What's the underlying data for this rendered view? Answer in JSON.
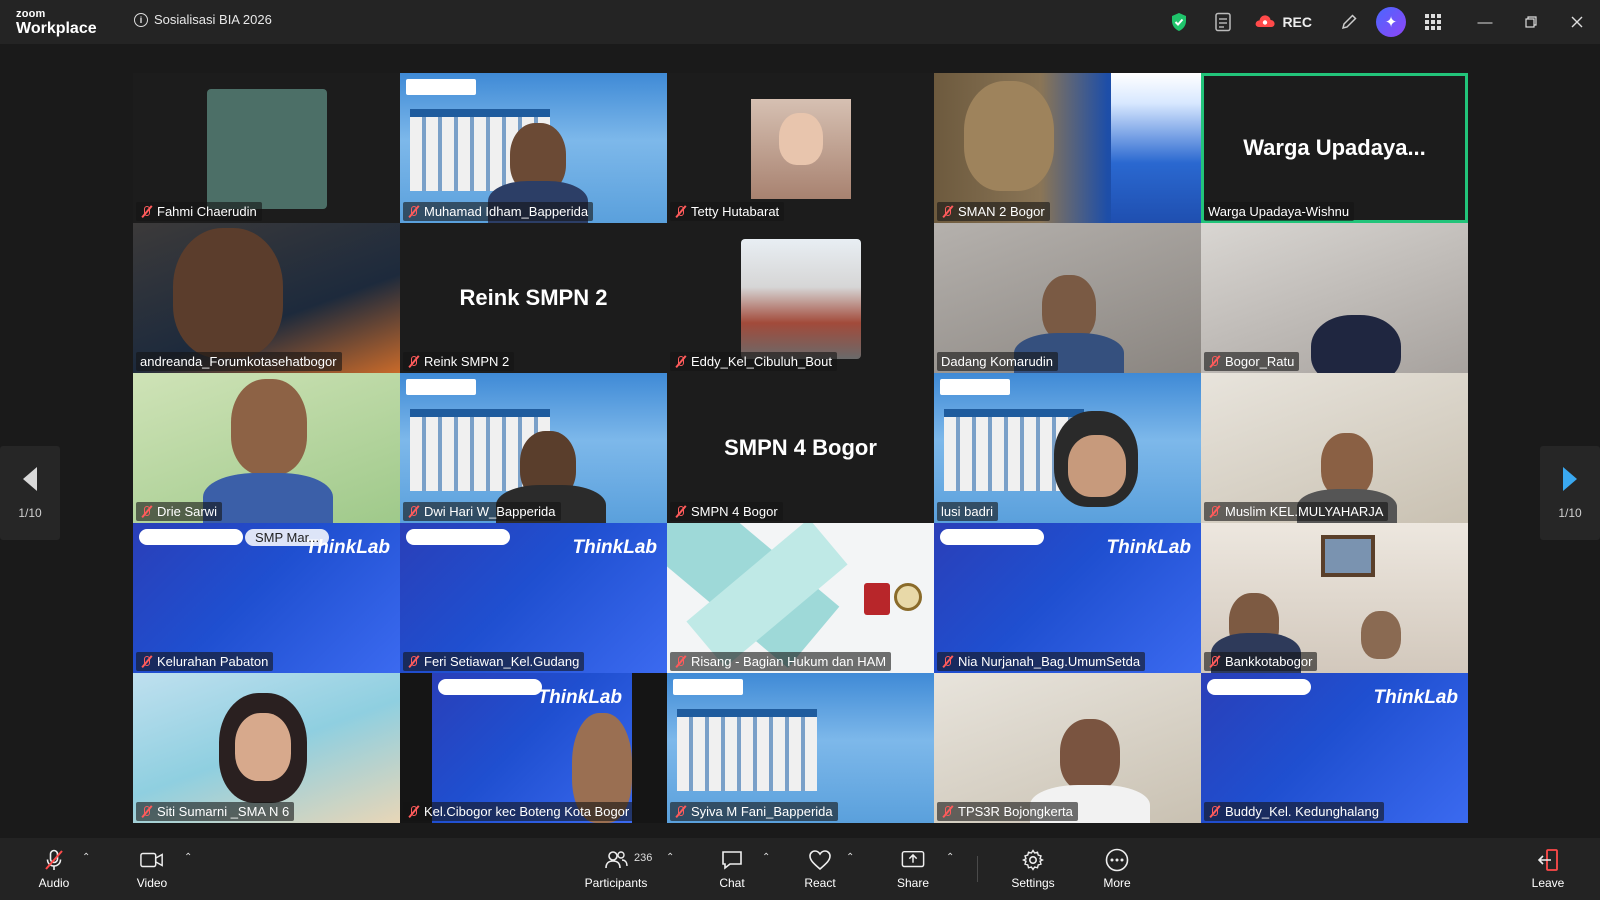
{
  "app": {
    "brand_top": "zoom",
    "brand_bottom": "Workplace",
    "meeting_title": "Sosialisasi BIA 2026"
  },
  "titlebar": {
    "rec_label": "REC",
    "icons": [
      "shield-check-icon",
      "notes-icon",
      "cloud-rec-icon",
      "pencil-icon",
      "ai-companion-icon",
      "apps-grid-icon"
    ]
  },
  "paging": {
    "left": "1/10",
    "right": "1/10"
  },
  "tiles": [
    {
      "name": "Fahmi Chaerudin",
      "muted": true,
      "style": "avatar"
    },
    {
      "name": "Muhamad Idham_Bapperida",
      "muted": true,
      "style": "bapperida"
    },
    {
      "name": "Tetty Hutabarat",
      "muted": true,
      "style": "photo"
    },
    {
      "name": "SMAN 2 Bogor",
      "muted": true,
      "style": "awarding"
    },
    {
      "name": "Warga Upadaya-Wishnu",
      "muted": false,
      "style": "text",
      "display_text": "Warga  Upadaya...",
      "active": true
    },
    {
      "name": "andreanda_Forumkotasehatbogor",
      "muted": false,
      "style": "video"
    },
    {
      "name": "Reink SMPN 2",
      "muted": true,
      "style": "text",
      "display_text": "Reink SMPN 2"
    },
    {
      "name": "Eddy_Kel_Cibuluh_Bout",
      "muted": true,
      "style": "photo"
    },
    {
      "name": "Dadang Komarudin",
      "muted": false,
      "style": "video"
    },
    {
      "name": "Bogor_Ratu",
      "muted": true,
      "style": "video"
    },
    {
      "name": "Drie Sarwi",
      "muted": true,
      "style": "video"
    },
    {
      "name": "Dwi Hari W_Bapperida",
      "muted": true,
      "style": "bapperida"
    },
    {
      "name": "SMPN 4 Bogor",
      "muted": true,
      "style": "text",
      "display_text": "SMPN 4 Bogor"
    },
    {
      "name": "lusi badri",
      "muted": false,
      "style": "bapperida"
    },
    {
      "name": "Muslim KEL.MULYAHARJA",
      "muted": true,
      "style": "video"
    },
    {
      "name": "Kelurahan Pabaton",
      "muted": true,
      "style": "thinklab",
      "overlay": "SMP  Mar..."
    },
    {
      "name": "Feri Setiawan_Kel.Gudang",
      "muted": true,
      "style": "thinklab"
    },
    {
      "name": "Risang - Bagian Hukum dan HAM",
      "muted": true,
      "style": "hukum"
    },
    {
      "name": "Nia Nurjanah_Bag.UmumSetda",
      "muted": true,
      "style": "thinklab"
    },
    {
      "name": "Bankkotabogor",
      "muted": true,
      "style": "video"
    },
    {
      "name": "Siti Sumarni _SMA N 6",
      "muted": true,
      "style": "video"
    },
    {
      "name": "Kel.Cibogor kec Boteng Kota Bogor",
      "muted": true,
      "style": "thinklab"
    },
    {
      "name": "Syiva M Fani_Bapperida",
      "muted": true,
      "style": "bapperida"
    },
    {
      "name": "TPS3R Bojongkerta",
      "muted": true,
      "style": "video"
    },
    {
      "name": "Buddy_Kel. Kedunghalang",
      "muted": true,
      "style": "thinklab"
    }
  ],
  "tile_overlays": {
    "thinklab": "ThinkLab"
  },
  "toolbar": {
    "audio": "Audio",
    "video": "Video",
    "participants": "Participants",
    "participants_count": "236",
    "chat": "Chat",
    "react": "React",
    "share": "Share",
    "settings": "Settings",
    "more": "More",
    "leave": "Leave"
  }
}
